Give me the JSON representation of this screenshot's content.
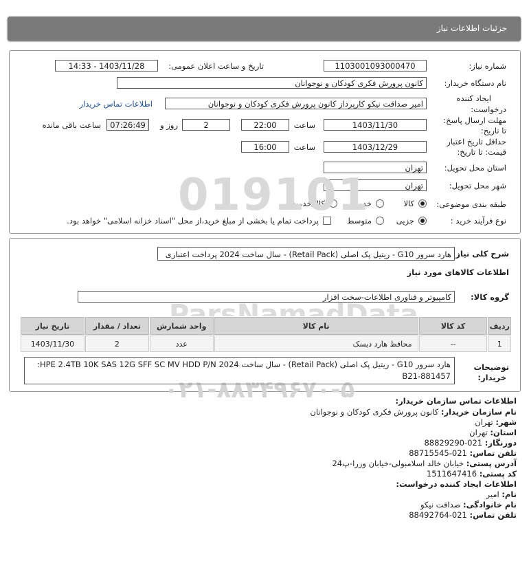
{
  "header": {
    "title": "جزئیات اطلاعات نیاز"
  },
  "form": {
    "need_number_label": "شماره نیاز:",
    "need_number": "1103001093000470",
    "announce_label": "تاریخ و ساعت اعلان عمومی:",
    "announce_value": "1403/11/28 - 14:33",
    "buyer_org_label": "نام دستگاه خریدار:",
    "buyer_org": "کانون پرورش فکری کودکان و نوجوانان",
    "creator_label_1": "ایجاد کننده",
    "creator_label_2": "درخواست:",
    "creator": "امیر صداقت نیکو کارپرداز کانون پرورش فکری کودکان و نوجوانان",
    "contact_link": "اطلاعات تماس خریدار",
    "deadline_label_1": "مهلت ارسال پاسخ:",
    "deadline_label_2": "تا تاریخ:",
    "deadline_date": "1403/11/30",
    "time_label": "ساعت",
    "deadline_time": "22:00",
    "days": "2",
    "days_label": "روز و",
    "remaining": "07:26:49",
    "remaining_label": "ساعت باقی مانده",
    "validity_label_1": "حداقل تاریخ اعتبار",
    "validity_label_2": "قیمت: تا تاریخ:",
    "validity_date": "1403/12/29",
    "validity_time": "16:00",
    "province_label": "استان محل تحویل:",
    "province": "تهران",
    "city_label": "شهر محل تحویل:",
    "city": "تهران",
    "category_label": "طبقه بندی موضوعی:",
    "category_options": [
      "کالا",
      "خدمت",
      "کالا/خدمت"
    ],
    "category_selected": "کالا",
    "process_label": "نوع فرآیند خرید :",
    "process_options": [
      "جزیی",
      "متوسط"
    ],
    "process_selected": "جزیی",
    "payment_note": "پرداخت تمام یا بخشی از مبلغ خرید،از محل \"اسناد خزانه اسلامی\" خواهد بود."
  },
  "details": {
    "summary_label": "شرح کلی نیاز:",
    "summary": "هارد سرور G10 - ریتیل پک اصلی (Retail Pack) - سال ساخت 2024 پرداخت اعتباری",
    "goods_info_title": "اطلاعات کالاهای مورد نیاز",
    "group_label": "گروه کالا:",
    "group": "کامپیوتر و فناوری اطلاعات-سخت افزار",
    "table": {
      "headers": [
        "ردیف",
        "کد کالا",
        "نام کالا",
        "واحد شمارش",
        "تعداد / مقدار",
        "تاریخ نیاز"
      ],
      "rows": [
        [
          "1",
          "--",
          "محافظ هارد دیسک",
          "عدد",
          "2",
          "1403/11/30"
        ]
      ]
    },
    "buyer_notes_label_1": "توضیحات",
    "buyer_notes_label_2": "خریدار:",
    "buyer_notes_line1": "هارد سرور G10 - ریتیل پک اصلی (Retail Pack) - سال ساخت 2024 HPE 2.4TB 10K SAS 12G SFF SC MV HDD P/N:",
    "buyer_notes_line2": "881457-B21"
  },
  "contact": {
    "title": "اطلاعات تماس سازمان خریدار:",
    "org_label": "نام سازمان خریدار:",
    "org": "کانون پرورش فکری کودکان و نوجوانان",
    "city_label": "شهر:",
    "city": "تهران",
    "province_label": "استان:",
    "province": "تهران",
    "fax_label": "دورنگار:",
    "fax": "021-88829290",
    "phone_label": "تلفن تماس:",
    "phone": "021-88715545",
    "address_label": "آدرس پستی:",
    "address": "خیابان خالد اسلامبولی-خیابان وزرا-پ24",
    "postal_label": "کد پستی:",
    "postal": "1511647416",
    "creator_title": "اطلاعات ایجاد کننده درخواست:",
    "name_label": "نام:",
    "name": "امیر",
    "family_label": "نام خانوادگی:",
    "family": "صداقت نیکو",
    "creator_phone_label": "تلفن تماس:",
    "creator_phone": "021-88492764"
  },
  "watermark": {
    "number": "019101",
    "brand": "ParsNamadData",
    "fa_line": "مرکز فراهم آوری و ارائه اطلاعات پارس نماد داده ها",
    "phone": "۰۲۱-۸۸۳۴۹۶۷۰-۵"
  }
}
